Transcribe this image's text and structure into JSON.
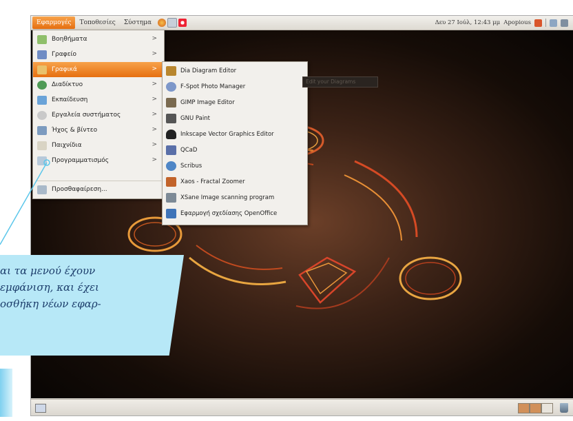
{
  "top_panel": {
    "menus": [
      "Εφαρμογές",
      "Τοποθεσίες",
      "Σύστημα"
    ],
    "clock": "Δευ 27 Ιούλ, 12:43 μμ",
    "user": "Apopious"
  },
  "applications_menu": {
    "items": [
      {
        "label": "Βοηθήματα",
        "icon": "accessories-icon",
        "color": "#8fbf6a",
        "submenu": true
      },
      {
        "label": "Γραφείο",
        "icon": "office-icon",
        "color": "#6f8cc4",
        "submenu": true
      },
      {
        "label": "Γραφικά",
        "icon": "graphics-icon",
        "color": "#e9c16b",
        "submenu": true,
        "highlighted": true
      },
      {
        "label": "Διαδίκτυο",
        "icon": "internet-icon",
        "color": "#4f9a55",
        "submenu": true
      },
      {
        "label": "Εκπαίδευση",
        "icon": "education-icon",
        "color": "#6aa3d8",
        "submenu": true
      },
      {
        "label": "Εργαλεία συστήματος",
        "icon": "system-tools-icon",
        "color": "#c9c9c9",
        "submenu": true
      },
      {
        "label": "Ήχος & βίντεο",
        "icon": "sound-video-icon",
        "color": "#7c9bbf",
        "submenu": true
      },
      {
        "label": "Παιχνίδια",
        "icon": "games-icon",
        "color": "#d9d4c4",
        "submenu": true
      },
      {
        "label": "Προγραμματισμός",
        "icon": "programming-icon",
        "color": "#b7c9da",
        "submenu": true
      },
      {
        "label": "Προσθαφαίρεση...",
        "icon": "add-remove-icon",
        "color": "#a9b9c9",
        "submenu": false
      }
    ]
  },
  "graphics_submenu": {
    "items": [
      {
        "label": "Dia Diagram Editor",
        "icon": "dia-icon",
        "color": "#b8862e"
      },
      {
        "label": "F-Spot Photo Manager",
        "icon": "f-spot-icon",
        "color": "#7d97c9"
      },
      {
        "label": "GIMP Image Editor",
        "icon": "gimp-icon",
        "color": "#7a6a4f"
      },
      {
        "label": "GNU Paint",
        "icon": "gnu-paint-icon",
        "color": "#555555"
      },
      {
        "label": "Inkscape Vector Graphics Editor",
        "icon": "inkscape-icon",
        "color": "#222222"
      },
      {
        "label": "QCaD",
        "icon": "qcad-icon",
        "color": "#5a6fa8"
      },
      {
        "label": "Scribus",
        "icon": "scribus-icon",
        "color": "#4f86c6"
      },
      {
        "label": "Xaos - Fractal Zoomer",
        "icon": "xaos-icon",
        "color": "#c2632a"
      },
      {
        "label": "XSane Image scanning program",
        "icon": "xsane-icon",
        "color": "#7d8a96"
      },
      {
        "label": "Εφαρμογή σχεδίασης OpenOffice",
        "icon": "openoffice-draw-icon",
        "color": "#3f74b8"
      }
    ]
  },
  "tooltip": "Edit your Diagrams",
  "annotation": {
    "lines": [
      "αι τα μενού έχουν",
      "εμφάνιση, και έχει",
      "οσθήκη νέων εφαρ-"
    ]
  },
  "colors": {
    "highlight": "#f08a2c",
    "callout": "#b7e8f7",
    "callout_text": "#1c3d6b"
  }
}
